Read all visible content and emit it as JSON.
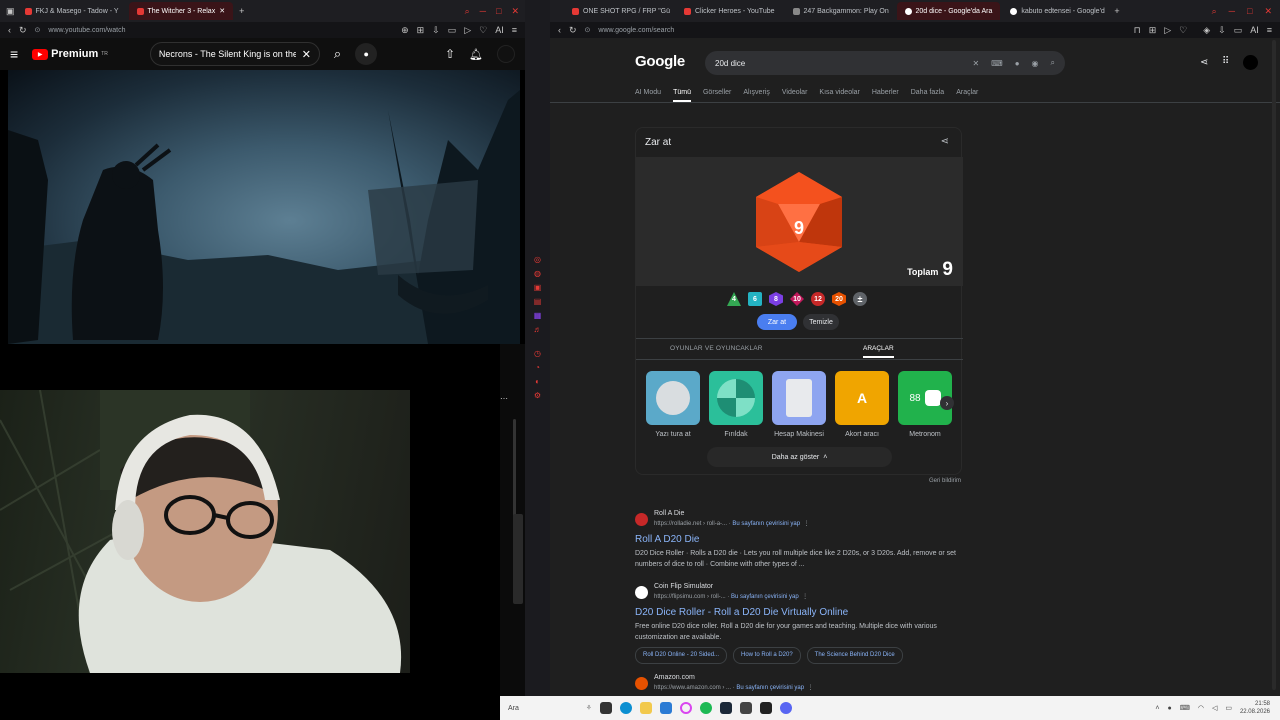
{
  "left_browser": {
    "tabs": [
      {
        "label": "FKJ & Masego - Tadow - Y"
      },
      {
        "label": "The Witcher 3 - Relax"
      }
    ],
    "url": "www.youtube.com/watch"
  },
  "youtube": {
    "logo": "Premium",
    "logo_sup": "TR",
    "search_value": "Necrons - The Silent King is on the Flo"
  },
  "right_browser": {
    "tabs": [
      {
        "label": "ONE SHOT RPG / FRP \"Gü"
      },
      {
        "label": "Clicker Heroes - YouTube"
      },
      {
        "label": "247 Backgammon: Play On"
      },
      {
        "label": "20d dice - Google'da Ara"
      },
      {
        "label": "kabuto edtensei - Google'd"
      }
    ],
    "url": "www.google.com/search"
  },
  "google": {
    "logo": "Google",
    "query": "20d dice",
    "tabs": [
      "AI Modu",
      "Tümü",
      "Görseller",
      "Alışveriş",
      "Videolar",
      "Kısa videolar",
      "Haberler",
      "Daha fazla",
      "Araçlar"
    ],
    "dice_card": {
      "title": "Zar at",
      "die_value": "9",
      "total_label": "Toplam",
      "total_value": "9",
      "dice": [
        "4",
        "6",
        "8",
        "10",
        "12",
        "20"
      ],
      "roll_button": "Zar at",
      "clear_button": "Temizle",
      "section_tabs": [
        "OYUNLAR VE OYUNCAKLAR",
        "ARAÇLAR"
      ],
      "tools": [
        "Yazı tura at",
        "Fırıldak",
        "Hesap Makinesi",
        "Akort aracı",
        "Metronom"
      ],
      "metronome_value": "88",
      "tuner_letter": "A",
      "show_less": "Daha az göster",
      "feedback": "Geri bildirim"
    },
    "results": [
      {
        "site": "Roll A Die",
        "url": "https://rolladie.net › roll-a-...",
        "translate": "Bu sayfanın çevirisini yap",
        "title": "Roll A D20 Die",
        "snippet_1": "D20 Dice Roller · Rolls a D20 die · Lets you roll multiple dice like 2 D20s, or 3 D20s. Add, remove or set",
        "snippet_2": "numbers of dice to roll · Combine with other types of ..."
      },
      {
        "site": "Coin Flip Simulator",
        "url": "https://flipsimu.com › roll-...",
        "translate": "Bu sayfanın çevirisini yap",
        "title": "D20 Dice Roller - Roll a D20 Die Virtually Online",
        "snippet_1": "Free online D20 dice roller. Roll a D20 die for your games and teaching. Multiple dice with various",
        "snippet_2": "customization are available.",
        "links": [
          "Roll D20 Online - 20 Sided...",
          "How to Roll a D20?",
          "The Science Behind D20 Dice"
        ]
      },
      {
        "site": "Amazon.com",
        "url": "https://www.amazon.com › ...",
        "translate": "Bu sayfanın çevirisini yap"
      }
    ]
  },
  "taskbar": {
    "search": "Ara",
    "time": "21:58",
    "date": "22.08.2026"
  }
}
